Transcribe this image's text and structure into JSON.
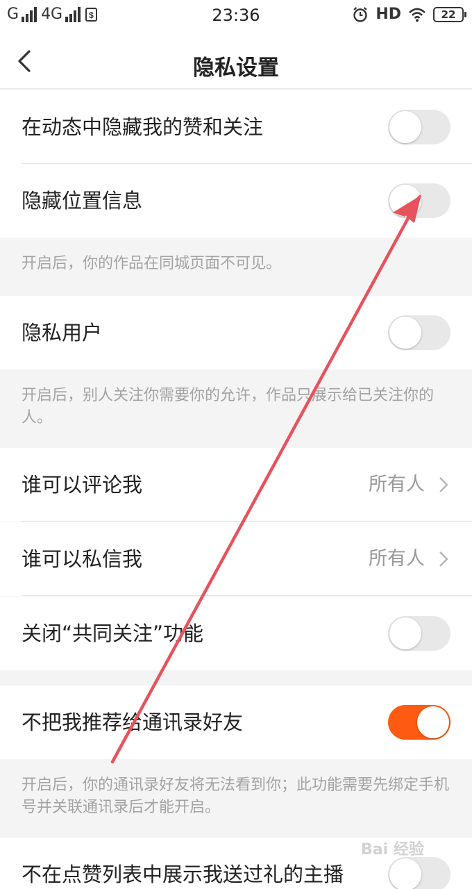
{
  "status_bar": {
    "carrier1": "G",
    "carrier2": "4G",
    "time": "23:36",
    "hd": "HD",
    "battery": "22"
  },
  "header": {
    "title": "隐私设置"
  },
  "settings": {
    "hide_likes": {
      "label": "在动态中隐藏我的赞和关注",
      "enabled": false
    },
    "hide_location": {
      "label": "隐藏位置信息",
      "enabled": false,
      "note": "开启后，你的作品在同城页面不可见。"
    },
    "private_user": {
      "label": "隐私用户",
      "enabled": false,
      "note": "开启后，别人关注你需要你的允许，作品只展示给已关注你的人。"
    },
    "who_comment": {
      "label": "谁可以评论我",
      "value": "所有人"
    },
    "who_message": {
      "label": "谁可以私信我",
      "value": "所有人"
    },
    "mutual_follow": {
      "label": "关闭“共同关注”功能",
      "enabled": false
    },
    "no_recommend_contacts": {
      "label": "不把我推荐给通讯录好友",
      "enabled": true,
      "note": "开启后，你的通讯录好友将无法看到你；此功能需要先绑定手机号并关联通讯录后才能开启。"
    },
    "hide_gift_hosts": {
      "label": "不在点赞列表中展示我送过礼的主播",
      "enabled": false
    }
  },
  "watermark": "Bai 经验",
  "colors": {
    "accent": "#ff5a11",
    "annotation_arrow": "#e8525c"
  }
}
